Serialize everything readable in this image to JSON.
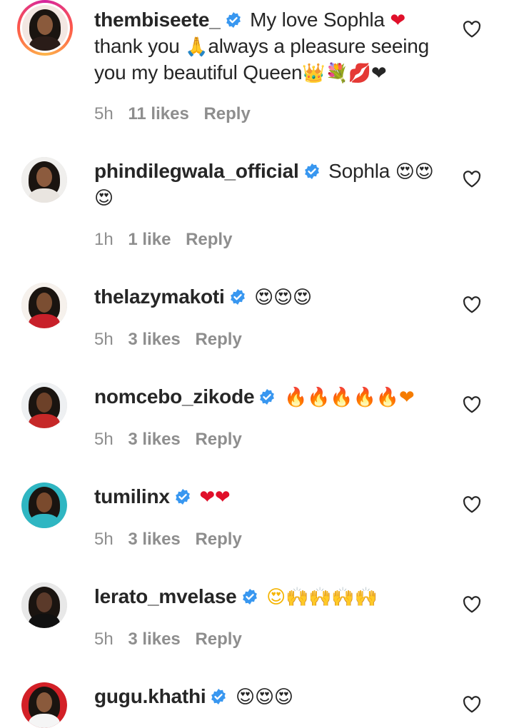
{
  "comments": [
    {
      "username": "thembiseete_",
      "text_parts": [
        "My love Sophla ",
        "❤",
        " thank you ",
        "🙏",
        "always a pleasure seeing you my beautiful Queen",
        "👑💐💋❤"
      ],
      "time": "5h",
      "likes": "11 likes",
      "reply": "Reply",
      "avatar_colors": {
        "bg": "#f3e7e2",
        "skin": "#8a5a3c",
        "body": "#2a1c18"
      }
    },
    {
      "username": "phindilegwala_official",
      "text_parts": [
        "Sophla ",
        "😍😍😍"
      ],
      "time": "1h",
      "likes": "1 like",
      "reply": "Reply",
      "avatar_colors": {
        "bg": "#f0efed",
        "skin": "#8c5b3e",
        "body": "#e9e5e0"
      }
    },
    {
      "username": "thelazymakoti",
      "text_parts": [
        "",
        "😍😍😍"
      ],
      "time": "5h",
      "likes": "3 likes",
      "reply": "Reply",
      "avatar_colors": {
        "bg": "#f6f1ec",
        "skin": "#7b4e32",
        "body": "#c8202a"
      }
    },
    {
      "username": "nomcebo_zikode",
      "text_parts": [
        "",
        "🔥🔥🔥🔥🔥❤"
      ],
      "time": "5h",
      "likes": "3 likes",
      "reply": "Reply",
      "avatar_colors": {
        "bg": "#eef0f2",
        "skin": "#6d4129",
        "body": "#c62828"
      }
    },
    {
      "username": "tumilinx",
      "text_parts": [
        "",
        "❤❤"
      ],
      "time": "5h",
      "likes": "3 likes",
      "reply": "Reply",
      "avatar_colors": {
        "bg": "#2fb6c2",
        "skin": "#7a4a2d",
        "body": "#2fb6c2"
      }
    },
    {
      "username": "lerato_mvelase",
      "text_parts": [
        "",
        "😍🙌🙌🙌🙌"
      ],
      "time": "5h",
      "likes": "3 likes",
      "reply": "Reply",
      "avatar_colors": {
        "bg": "#e8e8e8",
        "skin": "#5b3a2a",
        "body": "#111111"
      }
    },
    {
      "username": "gugu.khathi",
      "text_parts": [
        "",
        "😍😍😍"
      ],
      "time": "",
      "likes": "",
      "reply": "",
      "avatar_colors": {
        "bg": "#d32027",
        "skin": "#8a5a3c",
        "body": "#f5f5f5"
      }
    }
  ],
  "colors": {
    "verified_blue": "#3897f0",
    "meta_gray": "#8e8e8e",
    "text": "#262626",
    "heart_red": "#e0102a"
  },
  "icons": {
    "verified": "verified-badge-icon",
    "like": "heart-outline-icon"
  }
}
